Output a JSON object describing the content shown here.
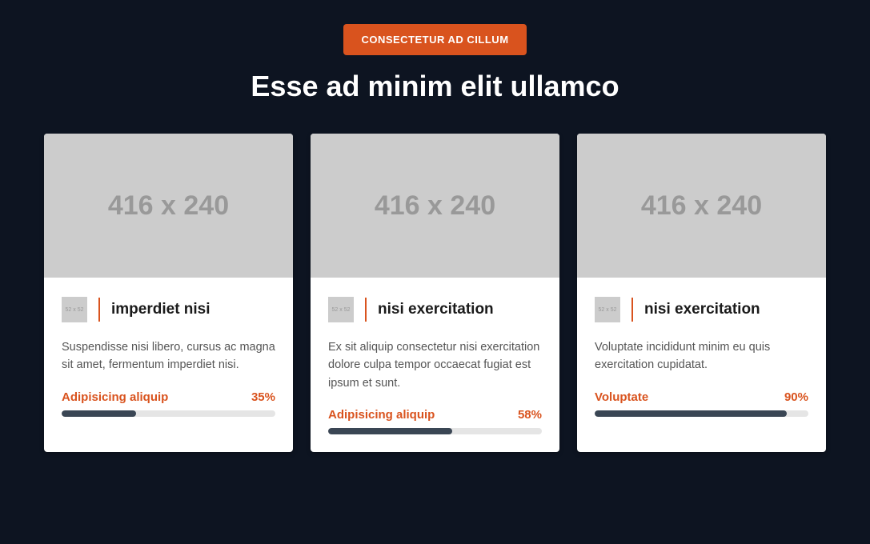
{
  "header": {
    "badge": "CONSECTETUR AD CILLUM",
    "title": "Esse ad minim elit ullamco"
  },
  "image_placeholder": "416 x 240",
  "icon_placeholder": "52 x 52",
  "cards": [
    {
      "title": "imperdiet nisi",
      "text": "Suspendisse nisi libero, cursus ac magna sit amet, fermentum imperdiet nisi.",
      "progress_label": "Adipisicing aliquip",
      "progress_pct": "35%",
      "progress_width": "35%"
    },
    {
      "title": "nisi exercitation",
      "text": "Ex sit aliquip consectetur nisi exercitation dolore culpa tempor occaecat fugiat est ipsum et sunt.",
      "progress_label": "Adipisicing aliquip",
      "progress_pct": "58%",
      "progress_width": "58%"
    },
    {
      "title": "nisi exercitation",
      "text": "Voluptate incididunt minim eu quis exercitation cupidatat.",
      "progress_label": "Voluptate",
      "progress_pct": "90%",
      "progress_width": "90%"
    }
  ]
}
